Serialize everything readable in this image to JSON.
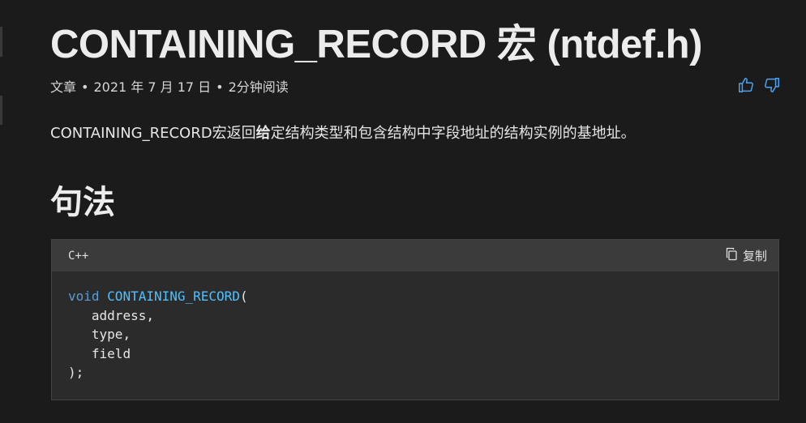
{
  "page": {
    "title": "CONTAINING_RECORD 宏 (ntdef.h)",
    "meta": {
      "type": "文章",
      "date": "2021 年 7 月 17 日",
      "read_time": "2分钟阅读",
      "separator": "•"
    },
    "feedback": {
      "like_icon": "thumbs-up-icon",
      "dislike_icon": "thumbs-down-icon",
      "accent_color": "#4ea3f1"
    },
    "description": {
      "before": "CONTAINING_RECORD宏返回",
      "bold": "给",
      "after": "定结构类型和包含结构中字段地址的结构实例的基地址。"
    },
    "syntax_heading": "句法"
  },
  "code_block": {
    "language": "C++",
    "copy_label": "复制",
    "copy_icon": "copy-icon",
    "keyword": "void",
    "function_name": "CONTAINING_RECORD",
    "open_paren": "(",
    "params": [
      "address,",
      "type,",
      "field"
    ],
    "close": ");",
    "colors": {
      "keyword": "#569cd6",
      "function": "#4fc1ff"
    }
  }
}
